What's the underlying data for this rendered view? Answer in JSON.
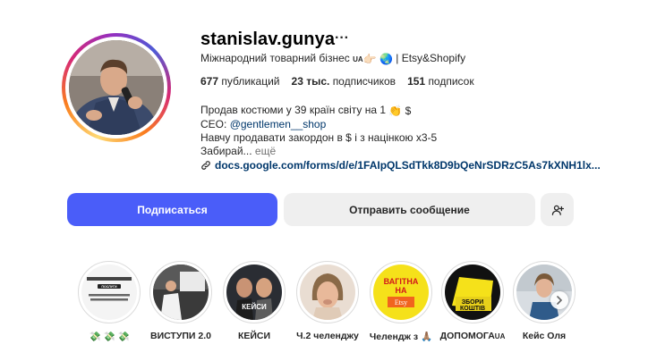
{
  "profile": {
    "username": "stanislav.gunya",
    "more": "···",
    "category_text": "Міжнародний товарний бізнес",
    "category_flag": "UA",
    "category_emoji": "👉🏻 🌏",
    "category_suffix": "| Etsy&Shopify",
    "stats": {
      "posts_count": "677",
      "posts_label": "публикаций",
      "followers_count": "23 тыс.",
      "followers_label": "подписчиков",
      "following_count": "151",
      "following_label": "подписок"
    },
    "bio": {
      "line1": "Продав костюми у 39 країн світу на 1",
      "line1_emoji": "👏 $",
      "line2_prefix": "CEO:",
      "line2_mention": "@gentlemen__shop",
      "line3": "Навчу продавати закордон в $ і з націнкою х3-5",
      "line4": "Забирай...",
      "more_label": "ещё"
    },
    "link": "docs.google.com/forms/d/e/1FAIpQLSdTkk8D9bQeNrSDRzC5As7kXNH1lx..."
  },
  "actions": {
    "follow_label": "Подписаться",
    "message_label": "Отправить сообщение",
    "suggest_icon": "add-person-icon"
  },
  "highlights": [
    {
      "label": "💸 💸 💸",
      "cover_text": "ПОСЛУГИ"
    },
    {
      "label": "ВИСТУПИ 2.0",
      "cover_text": ""
    },
    {
      "label": "КЕЙСИ",
      "cover_text": "КЕЙСИ"
    },
    {
      "label": "Ч.2 челенджу",
      "cover_text": ""
    },
    {
      "label": "Челендж з 🙏🏽",
      "cover_text_1": "ВАГІТНА",
      "cover_text_2": "НА",
      "cover_text_3": "Etsy"
    },
    {
      "label": "ДОПОМОГА",
      "label_flag": "UA",
      "cover_text_1": "ЗБОРИ",
      "cover_text_2": "КОШТІВ"
    },
    {
      "label": "Кейс Оля",
      "cover_text": ""
    }
  ],
  "colors": {
    "follow_button": "#4a5df9",
    "secondary_button": "#efefef",
    "link": "#00376b",
    "highlight_yellow": "#f5e11a"
  }
}
